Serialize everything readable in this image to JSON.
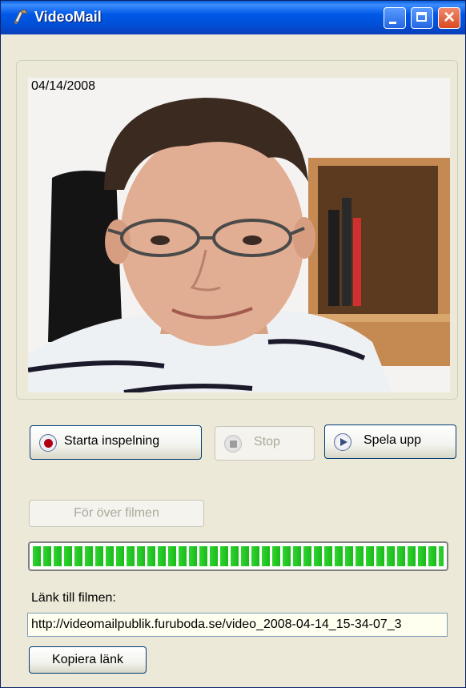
{
  "window": {
    "title": "VideoMail",
    "icon": "videomail-app-icon",
    "controls": [
      "minimize-icon",
      "maximize-icon",
      "close-icon"
    ]
  },
  "video": {
    "timestamp": "04/14/2008"
  },
  "buttons": {
    "start_label": "Starta inspelning",
    "stop_label": "Stop",
    "play_label": "Spela upp",
    "transfer_label": "För över filmen",
    "copy_label": "Kopiera länk"
  },
  "progress": {
    "fraction": 1.0,
    "color": "#2fd62f"
  },
  "link": {
    "label": "Länk till filmen:",
    "value": "http://videomailpublik.furuboda.se/video_2008-04-14_15-34-07_3"
  },
  "colors": {
    "titlebar": "#0058e6",
    "window_bg": "#ece9d8",
    "record_dot": "#b00012",
    "progress_green": "#2fd62f"
  }
}
